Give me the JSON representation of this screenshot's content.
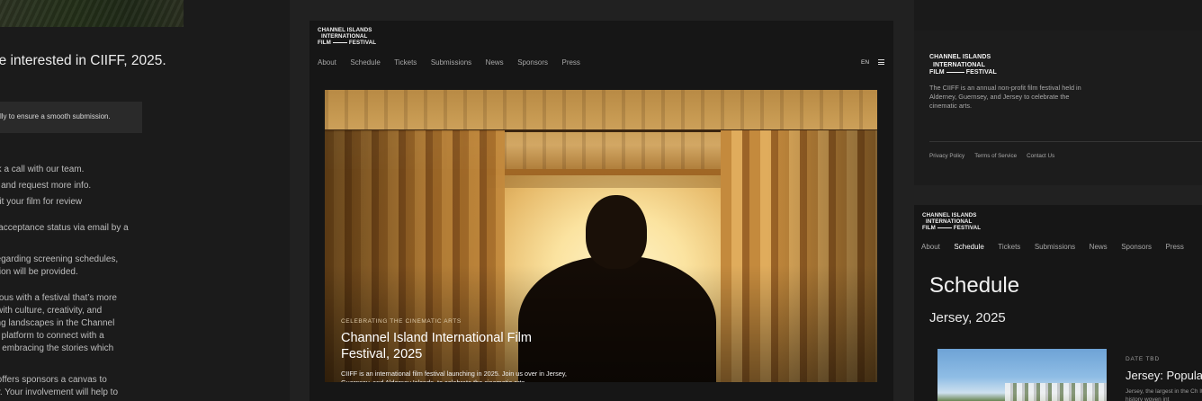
{
  "left_panel": {
    "heading": "’re interested in CIIFF, 2025.",
    "note": "lly to ensure a smooth submission.",
    "lines": [
      "book a call with our team.",
      " film, and request more info.",
      "ubmit your film for review",
      "m’s acceptance status via email by a",
      "ils regarding screening schedules,",
      "ditation will be provided.",
      "nymous with a festival that’s more",
      "led with culture, creativity, and",
      "taking landscapes in the Channel",
      "eled platform to connect with a",
      "n on embracing the stories which",
      "hat offers sponsors a canvas to",
      "bally. Your involvement will help to"
    ]
  },
  "logo": {
    "line1": "CHANNEL ISLANDS",
    "line2": "INTERNATIONAL",
    "line3_left": "FILM",
    "line3_right": "FESTIVAL"
  },
  "center": {
    "nav": [
      "About",
      "Schedule",
      "Tickets",
      "Submissions",
      "News",
      "Sponsors",
      "Press"
    ],
    "lang": "EN",
    "hero": {
      "eyebrow": "CELEBRATING THE CINEMATIC ARTS",
      "title": "Channel Island International Film Festival, 2025",
      "body": "CIIFF is an international film festival launching in 2025. Join us over in Jersey, Guernsey, and Alderney Islands, to celebrate the cinematic arts."
    }
  },
  "right_top": {
    "description": "The CIIFF is an annual non-profit film festival held in Alderney, Guernsey, and Jersey to celebrate the cinematic arts.",
    "footer_links": [
      "Privacy Policy",
      "Terms of Service",
      "Contact Us"
    ]
  },
  "right_bottom": {
    "nav": [
      "About",
      "Schedule",
      "Tickets",
      "Submissions",
      "News",
      "Sponsors",
      "Press"
    ],
    "active_nav": "Schedule",
    "title": "Schedule",
    "subtitle": "Jersey, 2025",
    "event": {
      "date": "DATE TBD",
      "name": "Jersey: Popula",
      "text": "Jersey, the largest in the Ch Its rich history woven int"
    }
  }
}
